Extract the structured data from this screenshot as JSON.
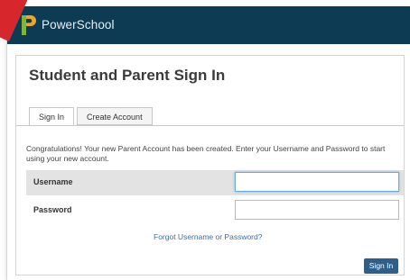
{
  "header": {
    "brand": "PowerSchool",
    "logo_icon": "powerschool-p-logo-icon",
    "background_color": "#0d3b53",
    "accent_color": "#d8262d"
  },
  "panel": {
    "title": "Student and Parent Sign In"
  },
  "tabs": [
    {
      "label": "Sign In",
      "active": true
    },
    {
      "label": "Create Account",
      "active": false
    }
  ],
  "message": "Congratulations! Your new Parent Account has been created. Enter your Username and Password to start using your new account.",
  "form": {
    "username_label": "Username",
    "username_value": "",
    "password_label": "Password",
    "password_value": ""
  },
  "forgot_link": "Forgot Username or Password?",
  "submit_label": "Sign In",
  "submit_color": "#2c5f8a"
}
